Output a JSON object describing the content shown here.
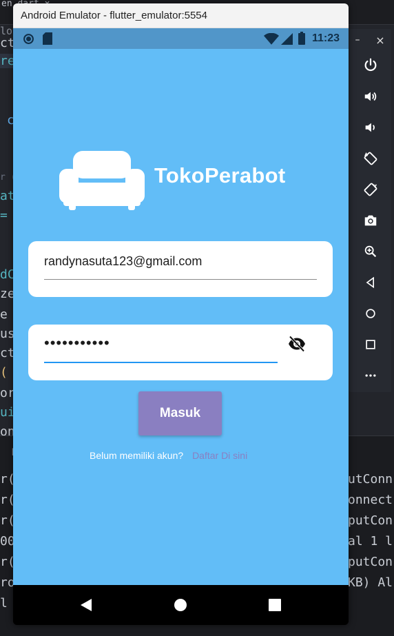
{
  "ide": {
    "tab_label": "en.dart ×",
    "code_lines": [
      "lo",
      "ct",
      "re",
      "",
      "",
      "c",
      "",
      "",
      "r (",
      "at",
      "=",
      "",
      "dC",
      "ze",
      "e",
      "us",
      "ct",
      "(",
      "or",
      "ui",
      "on",
      "  D"
    ],
    "right_lines": [
      "utConn",
      "onnect",
      "putCon",
      "al 1 l",
      "putCon",
      "KB) Al"
    ],
    "left_terminal": [
      "r(",
      "r(",
      "r(",
      "00",
      "r(",
      "ro",
      "l"
    ]
  },
  "window": {
    "title": "Android Emulator - flutter_emulator:5554"
  },
  "statusbar": {
    "time": "11:23"
  },
  "app": {
    "brand": "TokoPerabot",
    "email_value": "randynasuta123@gmail.com",
    "password_value": "•••••••••••",
    "login_label": "Masuk",
    "signup_prompt": "Belum memiliki akun?",
    "signup_link": "Daftar Di sini",
    "colors": {
      "background": "#62bdf7",
      "button": "#8a7fc1",
      "focus_underline": "#2196f3"
    }
  },
  "toolbar": {
    "minimize": "–",
    "close": "×",
    "icons": [
      "power-icon",
      "volume-up-icon",
      "volume-down-icon",
      "rotate-left-icon",
      "rotate-right-icon",
      "camera-icon",
      "zoom-icon",
      "back-icon",
      "home-icon",
      "overview-icon",
      "more-icon"
    ]
  }
}
